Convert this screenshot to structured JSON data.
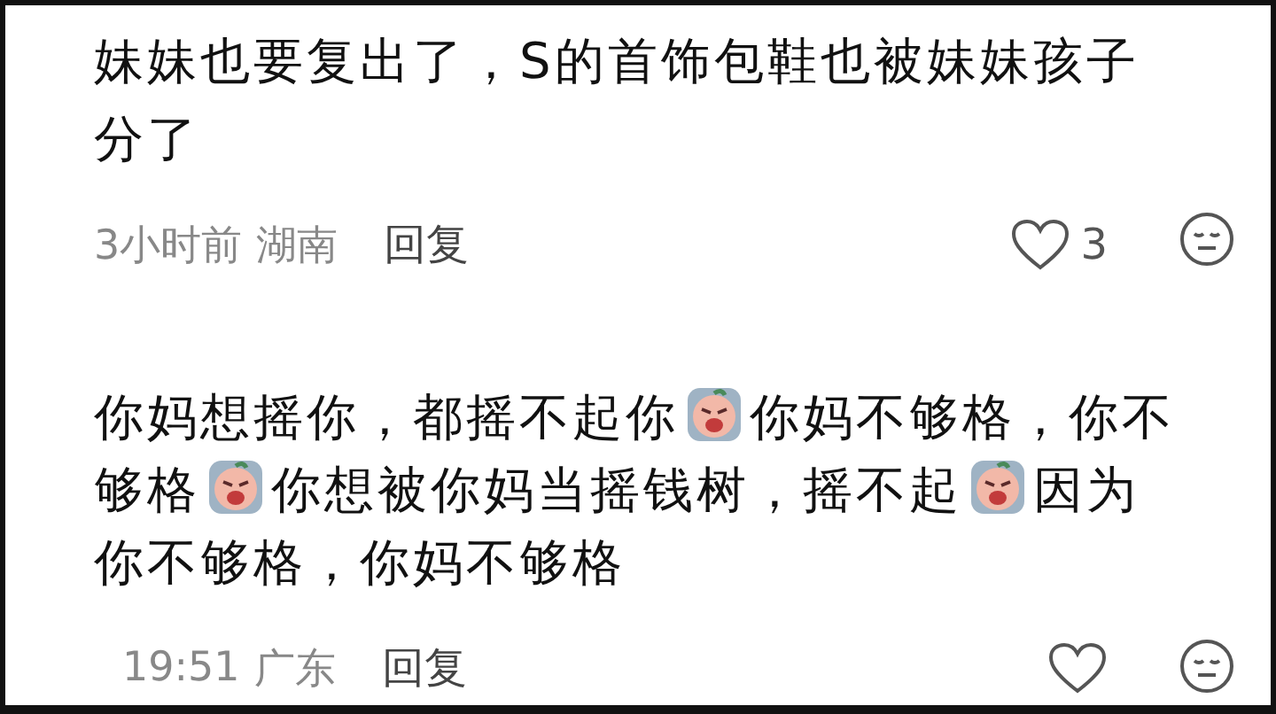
{
  "comments": [
    {
      "content": [
        {
          "kind": "text",
          "text": "妹妹也要复出了，S的首饰包鞋也被妹妹孩子分了"
        }
      ],
      "time": "3小时前",
      "location": "湖南",
      "reply": "回复",
      "likes": "3"
    },
    {
      "content": [
        {
          "kind": "text",
          "text": "你妈想摇你，都摇不起你"
        },
        {
          "kind": "emoji"
        },
        {
          "kind": "text",
          "text": "你妈不够格，你不够格"
        },
        {
          "kind": "emoji"
        },
        {
          "kind": "text",
          "text": "你想被你妈当摇钱树，摇不起"
        },
        {
          "kind": "emoji"
        },
        {
          "kind": "text",
          "text": "因为你不够格，你妈不够格"
        }
      ],
      "time": "19:51",
      "location": "广东",
      "reply": "回复"
    }
  ]
}
